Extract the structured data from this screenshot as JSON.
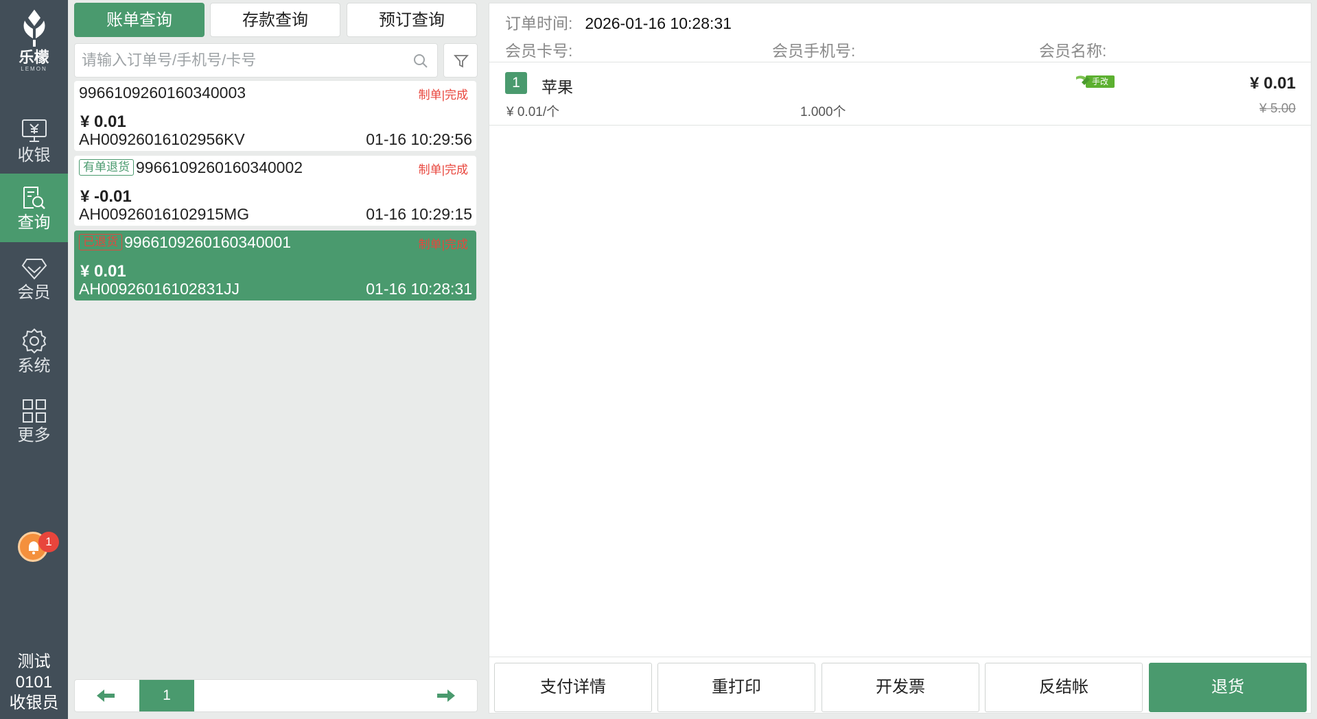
{
  "brand": {
    "name_cn": "乐檬",
    "name_en": "LEMON"
  },
  "nav": [
    {
      "label": "收银",
      "icon": "cashier-icon"
    },
    {
      "label": "查询",
      "icon": "query-icon",
      "active": true
    },
    {
      "label": "会员",
      "icon": "member-icon"
    },
    {
      "label": "系统",
      "icon": "gear-icon"
    },
    {
      "label": "更多",
      "icon": "grid-icon"
    }
  ],
  "notification": {
    "count": "1"
  },
  "user": {
    "name": "测试0101",
    "role": "收银员"
  },
  "tabs": [
    {
      "label": "账单查询",
      "active": true
    },
    {
      "label": "存款查询"
    },
    {
      "label": "预订查询"
    }
  ],
  "search": {
    "placeholder": "请输入订单号/手机号/卡号",
    "value": ""
  },
  "orders": [
    {
      "order_no": "9966109260160340003",
      "status": "制单|完成",
      "amount": "¥ 0.01",
      "code": "AH00926016102956KV",
      "time": "01-16 10:29:56",
      "tag": ""
    },
    {
      "order_no": "9966109260160340002",
      "status": "制单|完成",
      "amount": "¥ -0.01",
      "code": "AH00926016102915MG",
      "time": "01-16 10:29:15",
      "tag": "有单退货"
    },
    {
      "order_no": "9966109260160340001",
      "status": "制单|完成",
      "amount": "¥ 0.01",
      "code": "AH00926016102831JJ",
      "time": "01-16 10:28:31",
      "tag": "已退货",
      "selected": true
    }
  ],
  "pager": {
    "page": "1"
  },
  "detail": {
    "order_time_label": "订单时间:",
    "order_time": "2026-01-16 10:28:31",
    "card_label": "会员卡号:",
    "phone_label": "会员手机号:",
    "member_name_label": "会员名称:",
    "items": [
      {
        "index": "1",
        "name": "苹果",
        "flag": "手改",
        "price": "¥ 0.01",
        "unit_price": "¥ 0.01/个",
        "qty": "1.000个",
        "orig_price": "¥ 5.00"
      }
    ]
  },
  "actions": [
    {
      "label": "支付详情"
    },
    {
      "label": "重打印"
    },
    {
      "label": "开发票"
    },
    {
      "label": "反结帐"
    },
    {
      "label": "退货",
      "primary": true
    }
  ],
  "colors": {
    "accent": "#4a9a6e",
    "sidebar": "#424e58",
    "danger": "#e8453c"
  }
}
